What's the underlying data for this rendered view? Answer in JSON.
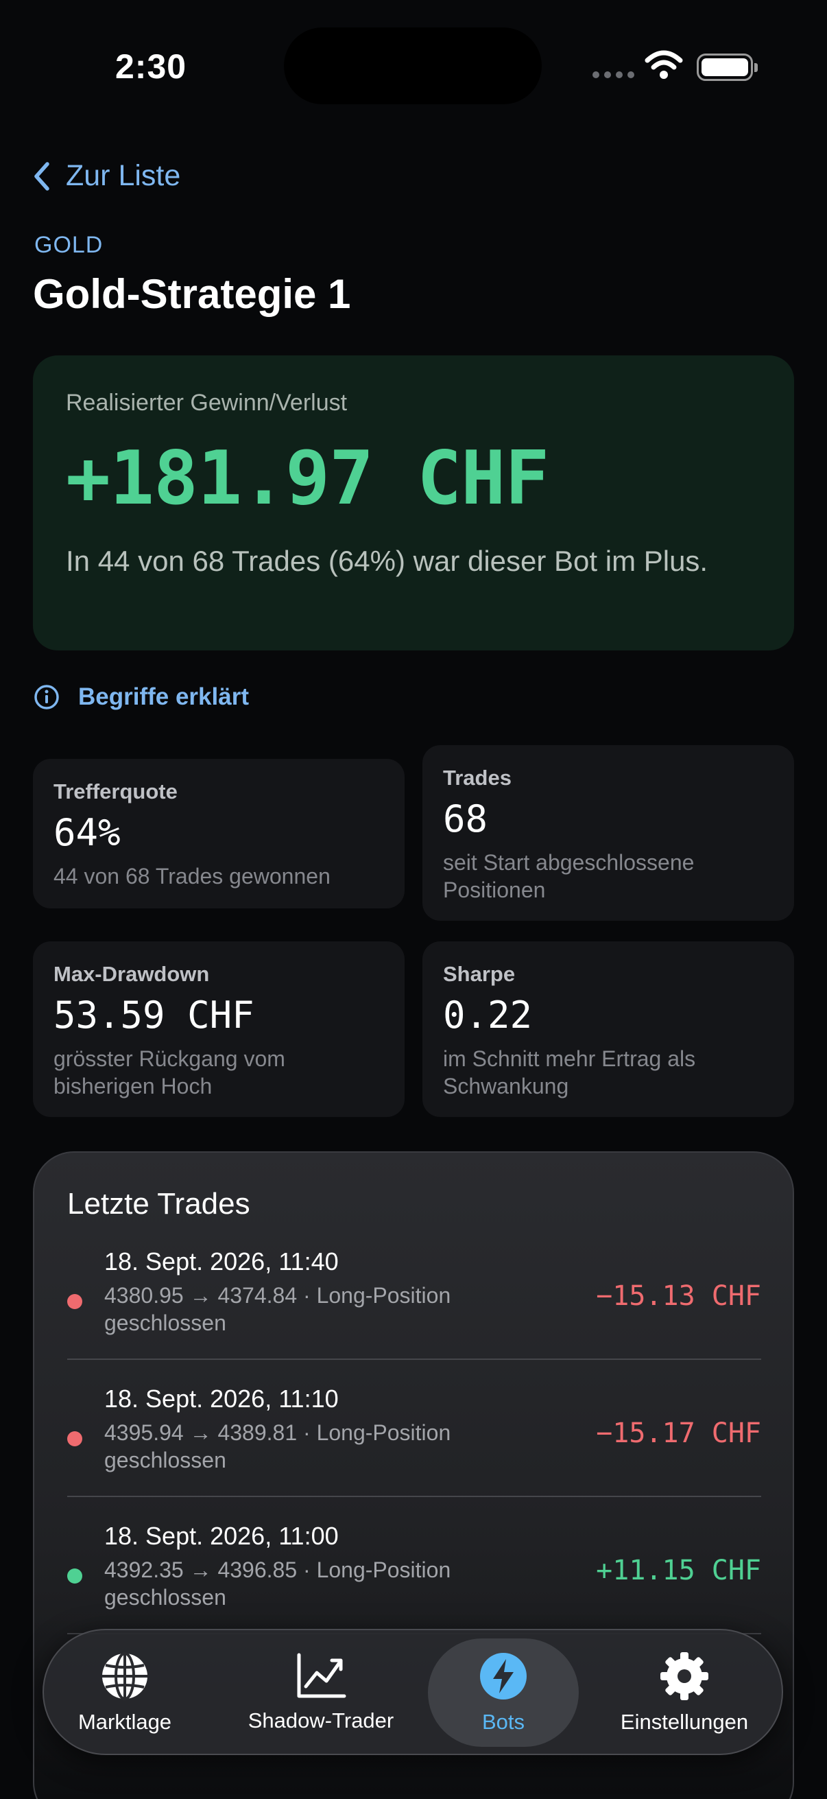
{
  "status_bar": {
    "time": "2:30"
  },
  "header": {
    "back_label": "Zur Liste",
    "asset_tag": "GOLD",
    "title": "Gold-Strategie 1"
  },
  "pnl": {
    "label": "Realisierter Gewinn/Verlust",
    "value": "+181.97 CHF",
    "description": "In 44 von 68 Trades (64%) war dieser Bot im Plus.",
    "color": "#4fd193"
  },
  "explain_link": {
    "label": "Begriffe erklärt"
  },
  "stats": [
    {
      "label": "Trefferquote",
      "value": "64%",
      "sub": "44 von 68 Trades gewonnen"
    },
    {
      "label": "Trades",
      "value": "68",
      "sub": "seit Start abgeschlossene Positionen"
    },
    {
      "label": "Max-Drawdown",
      "value": "53.59 CHF",
      "sub": "grösster Rückgang vom bisherigen Hoch"
    },
    {
      "label": "Sharpe",
      "value": "0.22",
      "sub": "im Schnitt mehr Ertrag als Schwankung"
    }
  ],
  "trades": {
    "title": "Letzte Trades",
    "items": [
      {
        "date": "18. Sept. 2026, 11:40",
        "desc": "4380.95 → 4374.84 · Long-Position geschlossen",
        "amount": "−15.13 CHF",
        "status": "loss",
        "color": "#ef6b6f"
      },
      {
        "date": "18. Sept. 2026, 11:10",
        "desc": "4395.94 → 4389.81 · Long-Position geschlossen",
        "amount": "−15.17 CHF",
        "status": "loss",
        "color": "#ef6b6f"
      },
      {
        "date": "18. Sept. 2026, 11:00",
        "desc": "4392.35 → 4396.85 · Long-Position geschlossen",
        "amount": "+11.15 CHF",
        "status": "win",
        "color": "#4fd193"
      }
    ]
  },
  "tabbar": {
    "tabs": [
      {
        "label": "Marktlage",
        "icon": "globe-icon",
        "active": false
      },
      {
        "label": "Shadow-Trader",
        "icon": "chart-line-icon",
        "active": false
      },
      {
        "label": "Bots",
        "icon": "bolt-icon",
        "active": true
      },
      {
        "label": "Einstellungen",
        "icon": "gear-icon",
        "active": false
      }
    ]
  }
}
